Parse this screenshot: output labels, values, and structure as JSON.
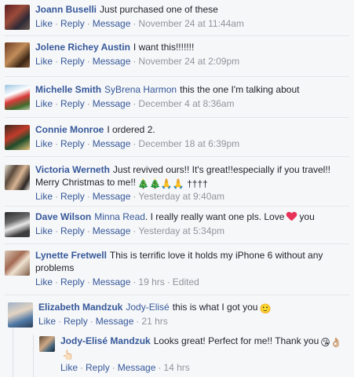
{
  "actions": {
    "like": "Like",
    "reply": "Reply",
    "message": "Message",
    "edited": "Edited"
  },
  "comments": [
    {
      "author": "Joann Buselli",
      "tag": "",
      "text": "Just purchased one of these",
      "time": "November 24 at 11:44am"
    },
    {
      "author": "Jolene Richey Austin",
      "tag": "",
      "text": "I want this!!!!!!!",
      "time": "November 24 at 2:09pm"
    },
    {
      "author": "Michelle Smith",
      "tag": "SyBrena Harmon",
      "text": "this the one I'm talking about",
      "time": "December 4 at 8:36am"
    },
    {
      "author": "Connie Monroe",
      "tag": "",
      "text": "I ordered 2.",
      "time": "December 18 at 6:39pm"
    },
    {
      "author": "Victoria Werneth",
      "tag": "",
      "text": "Just revived ours!! It's great!!especially if you travel!! Merry Christmas to me!!",
      "emoji": "🎄🎄🙏🙏 ††††",
      "time": "Yesterday at 9:40am"
    },
    {
      "author": "Dave Wilson",
      "tag": "Minna Read",
      "text": ". I really really want one pls. Love",
      "text2": "you",
      "time": "Yesterday at 5:34pm"
    },
    {
      "author": "Lynette Fretwell",
      "tag": "",
      "text": "This is terrific love it holds my iPhone 6 without any problems",
      "time": "19 hrs"
    },
    {
      "author": "Elizabeth Mandzuk",
      "tag": "Jody-Elisé",
      "text": "this is what I got you",
      "emoji": "🙂",
      "time": "21 hrs"
    },
    {
      "author": "Jody-Elisé Mandzuk",
      "tag": "",
      "text": "Looks great! Perfect for me!! Thank you",
      "emoji": "😘👌🏼",
      "emoji2": "👆🏻",
      "time": "14 hrs"
    }
  ]
}
